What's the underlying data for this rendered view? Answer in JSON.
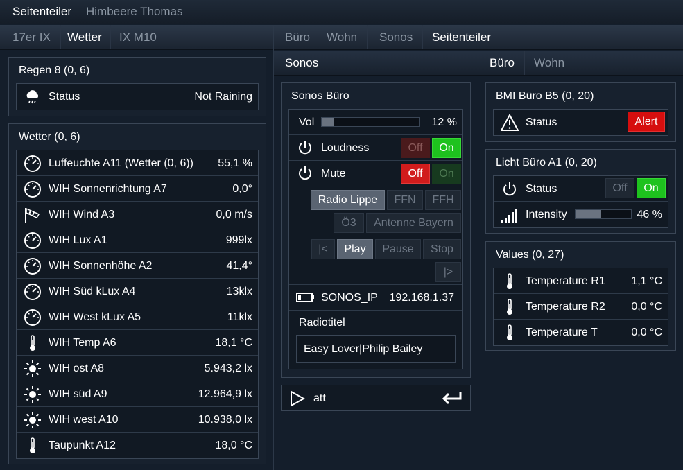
{
  "top_tabs": [
    "Seitenteiler",
    "Himbeere Thomas"
  ],
  "left_tabs": [
    "17er IX",
    "Wetter",
    "IX M10"
  ],
  "mid_tabs": [
    "Büro",
    "Wohn",
    "Sonos",
    "Seitenteiler"
  ],
  "mid_header": "Sonos",
  "right_tabs": [
    "Büro",
    "Wohn"
  ],
  "regen": {
    "title": "Regen 8 (0, 6)",
    "row": {
      "label": "Status",
      "value": "Not Raining",
      "icon": "cloud-rain-icon"
    }
  },
  "wetter": {
    "title": "Wetter (0, 6)",
    "rows": [
      {
        "label": "Luffeuchte A11 (Wetter (0, 6))",
        "value": "55,1 %",
        "icon": "gauge-icon"
      },
      {
        "label": "WIH Sonnenrichtung A7",
        "value": "0,0°",
        "icon": "gauge-icon"
      },
      {
        "label": "WIH Wind A3",
        "value": "0,0 m/s",
        "icon": "windsock-icon"
      },
      {
        "label": "WIH Lux A1",
        "value": "999lx",
        "icon": "gauge-icon"
      },
      {
        "label": "WIH Sonnenhöhe A2",
        "value": "41,4°",
        "icon": "gauge-icon"
      },
      {
        "label": "WIH Süd kLux A4",
        "value": "13klx",
        "icon": "gauge-icon"
      },
      {
        "label": "WIH West kLux A5",
        "value": "11klx",
        "icon": "gauge-icon"
      },
      {
        "label": "WIH Temp A6",
        "value": "18,1 °C",
        "icon": "thermometer-icon"
      },
      {
        "label": "WIH ost A8",
        "value": "5.943,2 lx",
        "icon": "sun-icon"
      },
      {
        "label": "WIH süd A9",
        "value": "12.964,9 lx",
        "icon": "sun-icon"
      },
      {
        "label": "WIH west A10",
        "value": "10.938,0 lx",
        "icon": "sun-icon"
      },
      {
        "label": "Taupunkt A12",
        "value": "18,0 °C",
        "icon": "thermometer-icon"
      }
    ]
  },
  "sonos": {
    "title": "Sonos Büro",
    "vol_label": "Vol",
    "vol_value": "12 %",
    "vol_fraction": 0.12,
    "loudness_label": "Loudness",
    "mute_label": "Mute",
    "off_label": "Off",
    "on_label": "On",
    "loudness_state": "on",
    "mute_state": "off",
    "stations": [
      "Radio Lippe",
      "FFN",
      "FFH",
      "Ö3",
      "Antenne Bayern"
    ],
    "selected_station": "Radio Lippe",
    "transport": [
      "|<",
      "Play",
      "Pause",
      "Stop",
      "|>"
    ],
    "active_transport": "Play",
    "ip_label": "SONOS_IP",
    "ip_value": "192.168.1.37",
    "radiotitel_label": "Radiotitel",
    "radiotitel_value": "Easy Lover|Philip Bailey"
  },
  "att": {
    "label": "att"
  },
  "bmi": {
    "title": "BMI Büro B5 (0, 20)",
    "status_label": "Status",
    "alert_label": "Alert"
  },
  "licht": {
    "title": "Licht Büro A1 (0, 20)",
    "status_label": "Status",
    "off_label": "Off",
    "on_label": "On",
    "state": "on",
    "intensity_label": "Intensity",
    "intensity_value": "46 %",
    "intensity_fraction": 0.46
  },
  "values": {
    "title": "Values (0, 27)",
    "rows": [
      {
        "label": "Temperature R1",
        "value": "1,1 °C",
        "icon": "thermometer-icon"
      },
      {
        "label": "Temperature R2",
        "value": "0,0 °C",
        "icon": "thermometer-icon"
      },
      {
        "label": "Temperature T",
        "value": "0,0 °C",
        "icon": "thermometer-icon"
      }
    ]
  },
  "colors": {
    "background": "#141e2b",
    "on_green": "#1ec21e",
    "off_red": "#d11c1c",
    "alert_red": "#d60e0e"
  }
}
